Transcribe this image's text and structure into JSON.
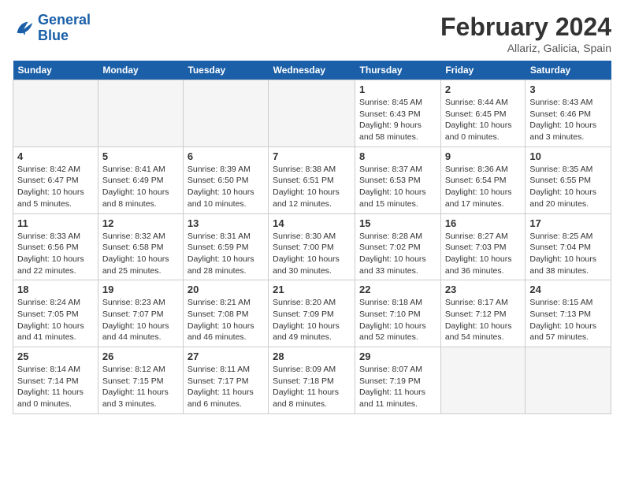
{
  "logo": {
    "line1": "General",
    "line2": "Blue"
  },
  "title": "February 2024",
  "location": "Allariz, Galicia, Spain",
  "days_of_week": [
    "Sunday",
    "Monday",
    "Tuesday",
    "Wednesday",
    "Thursday",
    "Friday",
    "Saturday"
  ],
  "weeks": [
    [
      {
        "day": "",
        "info": ""
      },
      {
        "day": "",
        "info": ""
      },
      {
        "day": "",
        "info": ""
      },
      {
        "day": "",
        "info": ""
      },
      {
        "day": "1",
        "info": "Sunrise: 8:45 AM\nSunset: 6:43 PM\nDaylight: 9 hours and 58 minutes."
      },
      {
        "day": "2",
        "info": "Sunrise: 8:44 AM\nSunset: 6:45 PM\nDaylight: 10 hours and 0 minutes."
      },
      {
        "day": "3",
        "info": "Sunrise: 8:43 AM\nSunset: 6:46 PM\nDaylight: 10 hours and 3 minutes."
      }
    ],
    [
      {
        "day": "4",
        "info": "Sunrise: 8:42 AM\nSunset: 6:47 PM\nDaylight: 10 hours and 5 minutes."
      },
      {
        "day": "5",
        "info": "Sunrise: 8:41 AM\nSunset: 6:49 PM\nDaylight: 10 hours and 8 minutes."
      },
      {
        "day": "6",
        "info": "Sunrise: 8:39 AM\nSunset: 6:50 PM\nDaylight: 10 hours and 10 minutes."
      },
      {
        "day": "7",
        "info": "Sunrise: 8:38 AM\nSunset: 6:51 PM\nDaylight: 10 hours and 12 minutes."
      },
      {
        "day": "8",
        "info": "Sunrise: 8:37 AM\nSunset: 6:53 PM\nDaylight: 10 hours and 15 minutes."
      },
      {
        "day": "9",
        "info": "Sunrise: 8:36 AM\nSunset: 6:54 PM\nDaylight: 10 hours and 17 minutes."
      },
      {
        "day": "10",
        "info": "Sunrise: 8:35 AM\nSunset: 6:55 PM\nDaylight: 10 hours and 20 minutes."
      }
    ],
    [
      {
        "day": "11",
        "info": "Sunrise: 8:33 AM\nSunset: 6:56 PM\nDaylight: 10 hours and 22 minutes."
      },
      {
        "day": "12",
        "info": "Sunrise: 8:32 AM\nSunset: 6:58 PM\nDaylight: 10 hours and 25 minutes."
      },
      {
        "day": "13",
        "info": "Sunrise: 8:31 AM\nSunset: 6:59 PM\nDaylight: 10 hours and 28 minutes."
      },
      {
        "day": "14",
        "info": "Sunrise: 8:30 AM\nSunset: 7:00 PM\nDaylight: 10 hours and 30 minutes."
      },
      {
        "day": "15",
        "info": "Sunrise: 8:28 AM\nSunset: 7:02 PM\nDaylight: 10 hours and 33 minutes."
      },
      {
        "day": "16",
        "info": "Sunrise: 8:27 AM\nSunset: 7:03 PM\nDaylight: 10 hours and 36 minutes."
      },
      {
        "day": "17",
        "info": "Sunrise: 8:25 AM\nSunset: 7:04 PM\nDaylight: 10 hours and 38 minutes."
      }
    ],
    [
      {
        "day": "18",
        "info": "Sunrise: 8:24 AM\nSunset: 7:05 PM\nDaylight: 10 hours and 41 minutes."
      },
      {
        "day": "19",
        "info": "Sunrise: 8:23 AM\nSunset: 7:07 PM\nDaylight: 10 hours and 44 minutes."
      },
      {
        "day": "20",
        "info": "Sunrise: 8:21 AM\nSunset: 7:08 PM\nDaylight: 10 hours and 46 minutes."
      },
      {
        "day": "21",
        "info": "Sunrise: 8:20 AM\nSunset: 7:09 PM\nDaylight: 10 hours and 49 minutes."
      },
      {
        "day": "22",
        "info": "Sunrise: 8:18 AM\nSunset: 7:10 PM\nDaylight: 10 hours and 52 minutes."
      },
      {
        "day": "23",
        "info": "Sunrise: 8:17 AM\nSunset: 7:12 PM\nDaylight: 10 hours and 54 minutes."
      },
      {
        "day": "24",
        "info": "Sunrise: 8:15 AM\nSunset: 7:13 PM\nDaylight: 10 hours and 57 minutes."
      }
    ],
    [
      {
        "day": "25",
        "info": "Sunrise: 8:14 AM\nSunset: 7:14 PM\nDaylight: 11 hours and 0 minutes."
      },
      {
        "day": "26",
        "info": "Sunrise: 8:12 AM\nSunset: 7:15 PM\nDaylight: 11 hours and 3 minutes."
      },
      {
        "day": "27",
        "info": "Sunrise: 8:11 AM\nSunset: 7:17 PM\nDaylight: 11 hours and 6 minutes."
      },
      {
        "day": "28",
        "info": "Sunrise: 8:09 AM\nSunset: 7:18 PM\nDaylight: 11 hours and 8 minutes."
      },
      {
        "day": "29",
        "info": "Sunrise: 8:07 AM\nSunset: 7:19 PM\nDaylight: 11 hours and 11 minutes."
      },
      {
        "day": "",
        "info": ""
      },
      {
        "day": "",
        "info": ""
      }
    ]
  ]
}
